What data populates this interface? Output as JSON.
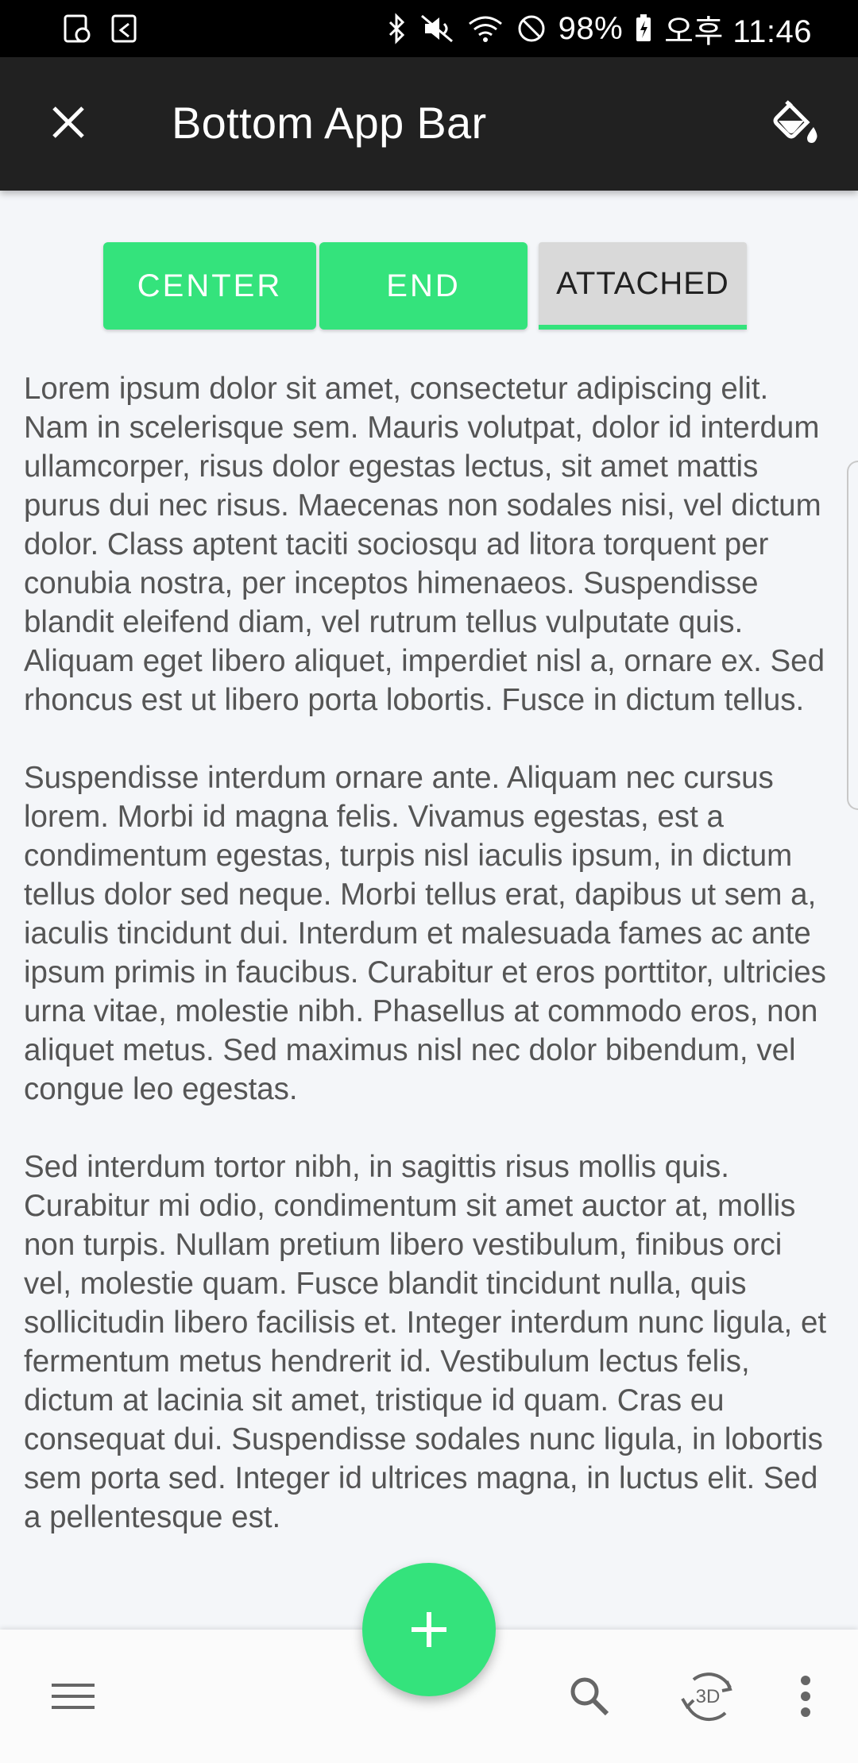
{
  "status_bar": {
    "battery": "98%",
    "time": "오후 11:46"
  },
  "toolbar": {
    "title": "Bottom App Bar",
    "icons": {
      "close": "close-icon",
      "theme": "format-color-fill-icon"
    }
  },
  "toggles": [
    {
      "label": "CENTER"
    },
    {
      "label": "END"
    },
    {
      "label": "ATTACHED"
    }
  ],
  "content": {
    "paragraphs": [
      "Lorem ipsum dolor sit amet, consectetur adipiscing elit. Nam in scelerisque sem. Mauris volutpat, dolor id interdum ullamcorper, risus dolor egestas lectus, sit amet mattis purus dui nec risus. Maecenas non sodales nisi, vel dictum dolor. Class aptent taciti sociosqu ad litora torquent per conubia nostra, per inceptos himenaeos. Suspendisse blandit eleifend diam, vel rutrum tellus vulputate quis. Aliquam eget libero aliquet, imperdiet nisl a, ornare ex. Sed rhoncus est ut libero porta lobortis. Fusce in dictum tellus.",
      " Suspendisse interdum ornare ante. Aliquam nec cursus lorem. Morbi id magna felis. Vivamus egestas, est a condimentum egestas, turpis nisl iaculis ipsum, in dictum tellus dolor sed neque. Morbi tellus erat, dapibus ut sem a, iaculis tincidunt dui. Interdum et malesuada fames ac ante ipsum primis in faucibus. Curabitur et eros porttitor, ultricies urna vitae, molestie nibh. Phasellus at commodo eros, non aliquet metus. Sed maximus nisl nec dolor bibendum, vel congue leo egestas.",
      " Sed interdum tortor nibh, in sagittis risus mollis quis. Curabitur mi odio, condimentum sit amet auctor at, mollis non turpis. Nullam pretium libero vestibulum, finibus orci vel, molestie quam. Fusce blandit tincidunt nulla, quis sollicitudin libero facilisis et. Integer interdum nunc ligula, et fermentum metus hendrerit id. Vestibulum lectus felis, dictum at lacinia sit amet, tristique id quam. Cras eu consequat dui. Suspendisse sodales nunc ligula, in lobortis sem porta sed. Integer id ultrices magna, in luctus elit. Sed a pellentesque est."
    ]
  },
  "bottom_bar": {
    "icons": [
      "menu-icon",
      "search-icon",
      "rotate-3d-icon",
      "more-vert-icon"
    ]
  },
  "fab": {
    "icon": "add-icon"
  },
  "colors": {
    "accent": "#34e37c",
    "toolbar": "#212121",
    "background": "#f4f6f9",
    "text": "#555555"
  }
}
